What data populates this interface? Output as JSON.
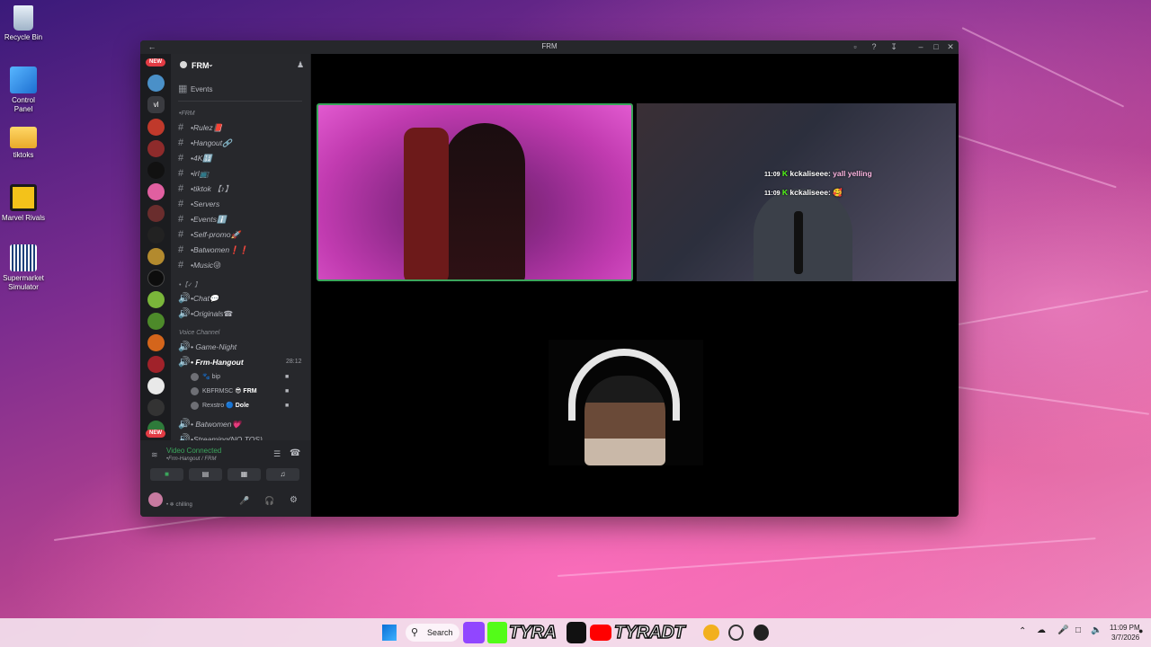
{
  "desktop": {
    "icons": [
      {
        "label": "Recycle Bin",
        "icon": "recycle-bin-icon"
      },
      {
        "label": "Control Panel",
        "icon": "control-panel-icon"
      },
      {
        "label": "tiktoks",
        "icon": "folder-icon"
      },
      {
        "label": "Marvel Rivals",
        "icon": "marvel-rivals-icon"
      },
      {
        "label": "Supermarket Simulator",
        "icon": "supermarket-simulator-icon"
      }
    ]
  },
  "window": {
    "title": "FRM",
    "server_name": "FRM",
    "events_label": "Events",
    "rail_badges": [
      "NEW",
      "NEW"
    ],
    "rail_text_item": "vl",
    "category_frm": "•FRM",
    "text_channels": [
      "•Rulez📕",
      "•Hangout🔗",
      "•4K🔢",
      "•irl📺",
      "•tiktok 【♪】",
      "•Servers",
      "•Eventsℹ️",
      "•Self-promo🚀",
      "•Batwomen❗❗",
      "•Music😜"
    ],
    "category_misc": "•【✓ 】",
    "voice_text_channels": [
      "•Chat💬",
      "•Originals☎"
    ],
    "category_voice": "Voice Channel",
    "voice_channels": [
      {
        "name": "• Game-Night",
        "active": false
      },
      {
        "name": "• Frm-Hangout",
        "active": true,
        "timer": "28:12"
      },
      {
        "name": "• Batwomen💗",
        "active": false
      },
      {
        "name": "•Streaming(NO TOS)",
        "active": false
      }
    ],
    "voice_users": [
      {
        "name": "🐾 bip",
        "tag": ""
      },
      {
        "name": "KBFRMSC",
        "tag": "😎 FRM"
      },
      {
        "name": "Rexstro",
        "tag": "🔵 Dole"
      }
    ],
    "voice_panel": {
      "status": "Video Connected",
      "location": "•Frm-Hangout / FRM"
    },
    "user_panel": {
      "status": "• ❄ chilling"
    },
    "stream_chat": [
      {
        "time": "11:09",
        "user": "kckaliseee:",
        "message": "yall yelling"
      },
      {
        "time": "11:09",
        "user": "kckaliseee:",
        "message": "🥰"
      }
    ]
  },
  "taskbar": {
    "search_label": "Search",
    "brand_name_1": "TYRA",
    "brand_name_2": "TYRADT",
    "time": "11:09 PM",
    "date": "3/7/2026"
  },
  "colors": {
    "discord_bg": "#1e1f22",
    "sidebar_bg": "#27282c",
    "video_connected": "#3ba55c",
    "brand_pink": "#ff6fb5",
    "kick_green": "#53fc18",
    "twitch_purple": "#9146ff",
    "youtube_red": "#ff0000"
  }
}
